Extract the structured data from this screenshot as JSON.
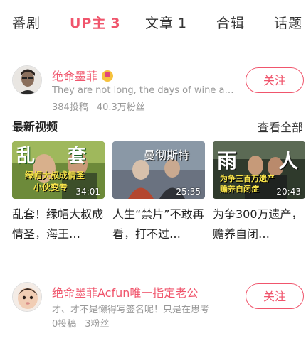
{
  "tabs": [
    {
      "label": "番剧",
      "count": ""
    },
    {
      "label": "UP主",
      "count": "3"
    },
    {
      "label": "文章",
      "count": "1"
    },
    {
      "label": "合辑",
      "count": ""
    },
    {
      "label": "话题",
      "count": ""
    }
  ],
  "active_tab": "UP主",
  "accent_color": "#f0556c",
  "users": [
    {
      "name": "绝命墨菲",
      "badge_icon": "verified-badge-icon",
      "signature": "They are not long, the days of wine and roses",
      "posts": "384投稿",
      "fans": "40.3万粉丝",
      "follow_label": "关注"
    },
    {
      "name": "绝命墨菲Acfun唯一指定老公",
      "signature": "才、才不是懒得写签名呢！只是在思考",
      "posts": "0投稿",
      "fans": "3粉丝",
      "follow_label": "关注"
    }
  ],
  "latest_videos": {
    "title": "最新视频",
    "see_all": "查看全部",
    "items": [
      {
        "title": "乱套！绿帽大叔成情圣，海王…",
        "duration": "34:01",
        "thumb_main": "乱",
        "thumb_main2": "套",
        "thumb_sub1": "绿帽大叔成情圣",
        "thumb_sub2": "小伙变专"
      },
      {
        "title": "人生“禁片”不敢再看，打不过…",
        "duration": "25:35",
        "thumb_main": "曼彻斯特"
      },
      {
        "title": "为争300万遗产，赡养自闭…",
        "duration": "20:43",
        "thumb_main": "雨",
        "thumb_main2": "人",
        "thumb_sub1": "为争三百万遗产",
        "thumb_sub2": "赡养自闭症"
      }
    ]
  }
}
